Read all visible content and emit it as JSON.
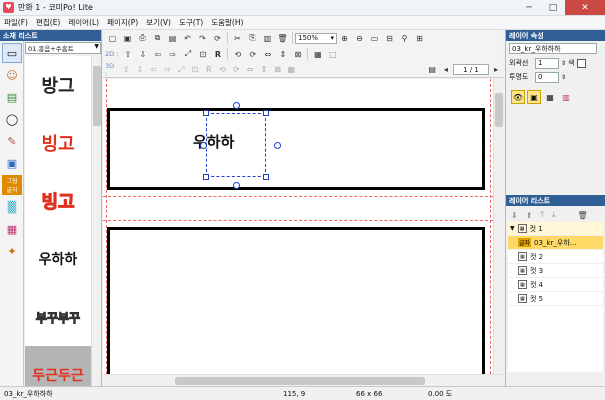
{
  "window": {
    "title": "만화 1 - 코미Po! Lite",
    "app_icon": "comipo-app-icon",
    "minimize": "─",
    "maximize": "□",
    "close": "✕"
  },
  "menu": [
    "파일(F)",
    "편집(E)",
    "레이어(L)",
    "페이지(P)",
    "보기(V)",
    "도구(T)",
    "도움말(H)"
  ],
  "material_list": {
    "header": "소재 리스트",
    "category": "01.흥음+수흠트",
    "tools": [
      "select-icon",
      "character-icon",
      "background-icon",
      "balloon-icon",
      "vehicle-icon",
      "box-icon",
      "effect-text-icon",
      "screentone-icon",
      "frame-icon",
      "mixed-icon"
    ],
    "tool_glyphs": [
      "▭",
      "☺",
      "▤",
      "◯",
      "✎",
      "▣",
      "字",
      "▒",
      "▦",
      "✦"
    ],
    "tool_texts": [
      "",
      "",
      "",
      "",
      "",
      "",
      "그림\n글자",
      "",
      "",
      ""
    ],
    "thumbnails": [
      {
        "text": "방그",
        "color": "#222222"
      },
      {
        "text": "빙고",
        "color": "#e0301e"
      },
      {
        "text": "빙고",
        "color": "#f5b800"
      },
      {
        "text": "우하하",
        "color": "#111111"
      },
      {
        "text": "부꾸부꾸",
        "color": "#666666"
      },
      {
        "text": "두근두근",
        "color": "#e0301e"
      }
    ]
  },
  "toolbar": {
    "zoom": "150%",
    "mode_2d": "2D :",
    "mode_3d": "3D :",
    "page": "1 / 1",
    "row1_icons": [
      "new-icon",
      "open-icon",
      "save-icon",
      "print-icon",
      "undo-icon",
      "redo-icon",
      "refresh-icon",
      "cut-icon",
      "copy-icon",
      "paste-icon",
      "delete-icon",
      "zoom-in-icon",
      "zoom-out-icon",
      "fit-page-icon",
      "fit-width-icon",
      "snap-icon",
      "grid-icon"
    ],
    "row2_icons": [
      "move-up-icon",
      "move-down-icon",
      "move-left-icon",
      "move-right-icon",
      "fit-icon",
      "align-icon",
      "r-icon",
      "rotate-left-icon",
      "rotate-right-icon",
      "flip-h-icon",
      "flip-v-icon",
      "qr-icon",
      "export-icon"
    ],
    "row3_icons": [
      "3d-1",
      "3d-2",
      "3d-3",
      "3d-4",
      "3d-5",
      "3d-6",
      "3d-7",
      "3d-8",
      "3d-9",
      "3d-10",
      "3d-11",
      "3d-12",
      "3d-13",
      "3d-14"
    ]
  },
  "canvas": {
    "selected_text": "우하하"
  },
  "layer_props": {
    "header": "레이어 속성",
    "name": "03_kr_우하하하",
    "outline_label": "외곽선",
    "outline_value": "1",
    "color_label": "색",
    "opacity_label": "투명도",
    "opacity_value": "0"
  },
  "layer_list": {
    "header": "레이어 리스트",
    "items": [
      {
        "label": "컷 1",
        "expanded": true
      },
      {
        "label": "03_kr_우하...",
        "tag": "글자",
        "sub": true
      },
      {
        "label": "컷 2"
      },
      {
        "label": "컷 3"
      },
      {
        "label": "컷 4"
      },
      {
        "label": "컷 5"
      }
    ]
  },
  "status": {
    "name": "03_kr_우하하하",
    "pos": "115, 9",
    "size": "66 x 66",
    "angle": "0.00 도"
  }
}
